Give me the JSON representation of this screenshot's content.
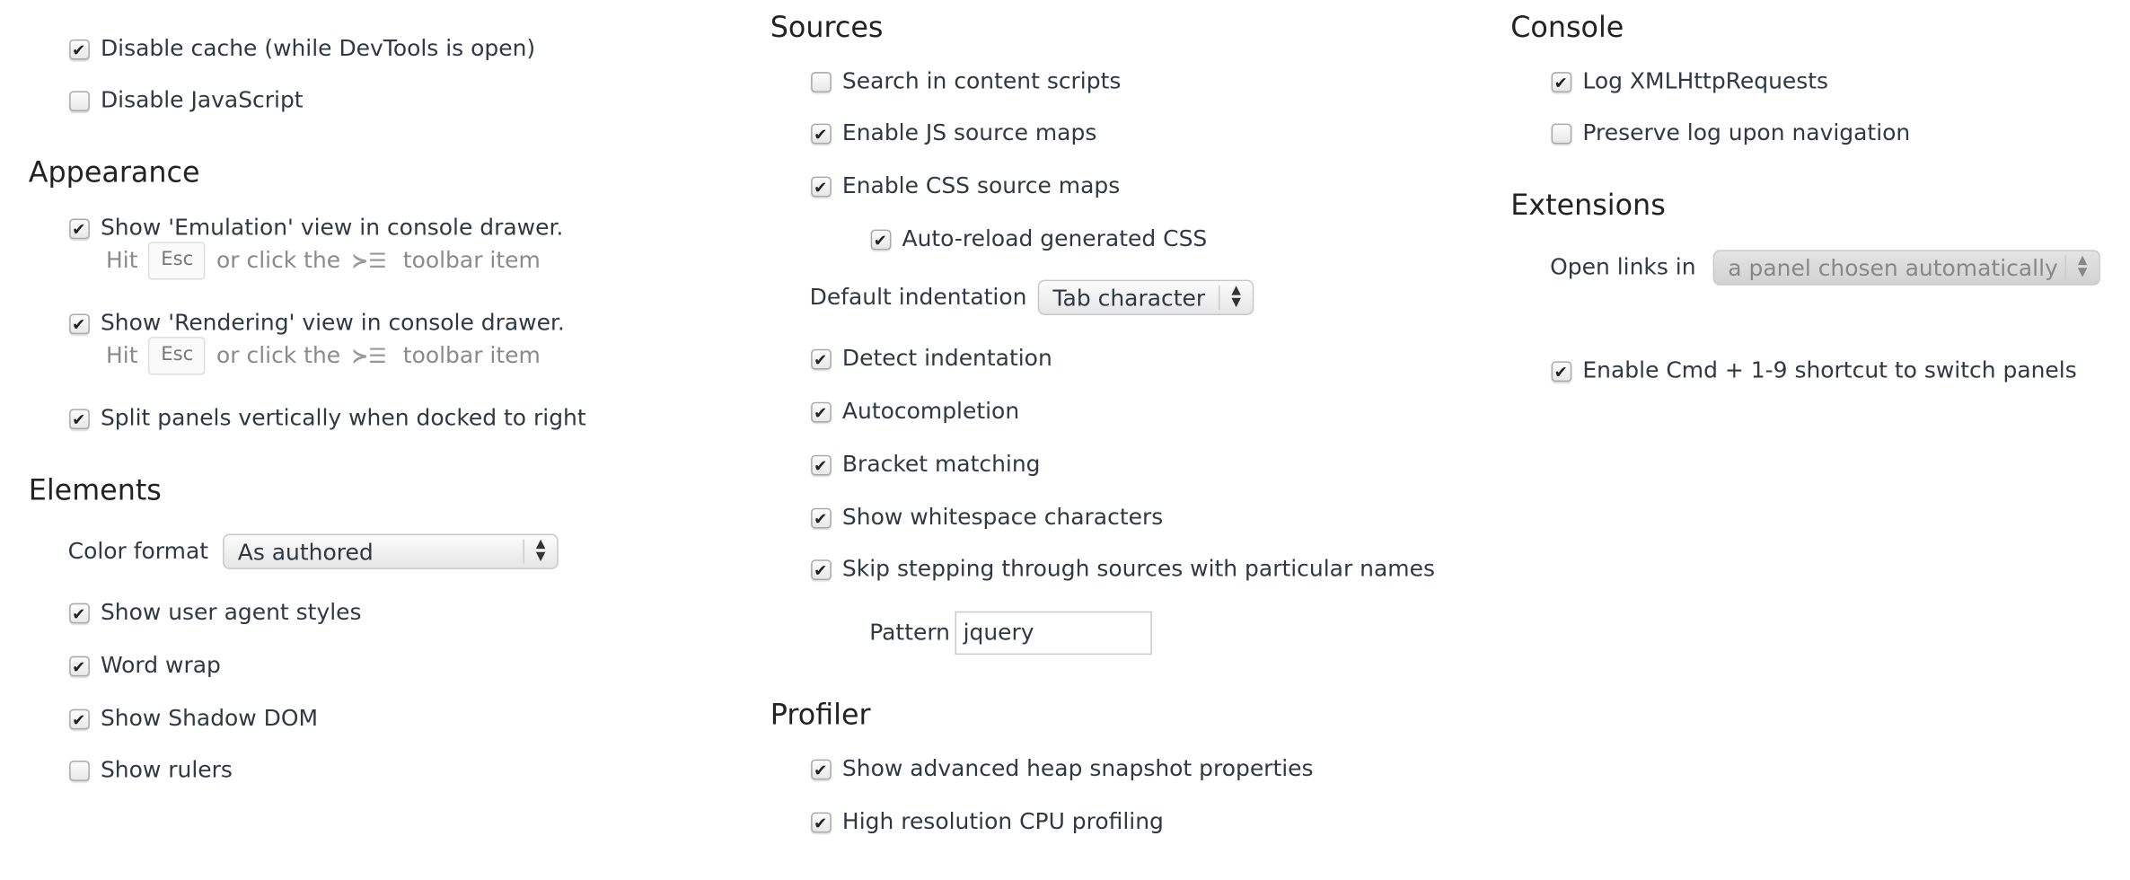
{
  "left": {
    "general": [
      {
        "label": "Disable cache (while DevTools is open)",
        "checked": true
      },
      {
        "label": "Disable JavaScript",
        "checked": false
      }
    ],
    "appearance": {
      "title": "Appearance",
      "emulation": {
        "label": "Show 'Emulation' view in console drawer.",
        "checked": true,
        "hint_hit": "Hit",
        "hint_key": "Esc",
        "hint_or": "or click the",
        "hint_toolbar": "toolbar item"
      },
      "rendering": {
        "label": "Show 'Rendering' view in console drawer.",
        "checked": true,
        "hint_hit": "Hit",
        "hint_key": "Esc",
        "hint_or": "or click the",
        "hint_toolbar": "toolbar item"
      },
      "split": {
        "label": "Split panels vertically when docked to right",
        "checked": true
      }
    },
    "elements": {
      "title": "Elements",
      "color_format_label": "Color format",
      "color_format_value": "As authored",
      "items": [
        {
          "label": "Show user agent styles",
          "checked": true
        },
        {
          "label": "Word wrap",
          "checked": true
        },
        {
          "label": "Show Shadow DOM",
          "checked": true
        },
        {
          "label": "Show rulers",
          "checked": false
        }
      ]
    }
  },
  "middle": {
    "sources": {
      "title": "Sources",
      "items": [
        {
          "label": "Search in content scripts",
          "checked": false
        },
        {
          "label": "Enable JS source maps",
          "checked": true
        },
        {
          "label": "Enable CSS source maps",
          "checked": true
        },
        {
          "label": "Auto-reload generated CSS",
          "checked": true
        }
      ],
      "indentation_label": "Default indentation",
      "indentation_value": "Tab character",
      "items2": [
        {
          "label": "Detect indentation",
          "checked": true
        },
        {
          "label": "Autocompletion",
          "checked": true
        },
        {
          "label": "Bracket matching",
          "checked": true
        },
        {
          "label": "Show whitespace characters",
          "checked": true
        },
        {
          "label": "Skip stepping through sources with particular names",
          "checked": true
        }
      ],
      "pattern_label": "Pattern",
      "pattern_value": "jquery"
    },
    "profiler": {
      "title": "Profiler",
      "items": [
        {
          "label": "Show advanced heap snapshot properties",
          "checked": true
        },
        {
          "label": "High resolution CPU profiling",
          "checked": true
        }
      ]
    }
  },
  "right": {
    "console": {
      "title": "Console",
      "items": [
        {
          "label": "Log XMLHttpRequests",
          "checked": true
        },
        {
          "label": "Preserve log upon navigation",
          "checked": false
        }
      ]
    },
    "extensions": {
      "title": "Extensions",
      "open_links_label": "Open links in",
      "open_links_value": "a panel chosen automatically",
      "cmd_shortcut": {
        "label": "Enable Cmd + 1-9 shortcut to switch panels",
        "checked": true
      }
    }
  },
  "icons": {
    "checkbox": "checkmark-icon",
    "drawer": "console-drawer-icon",
    "select": "up-down-arrows-icon"
  }
}
